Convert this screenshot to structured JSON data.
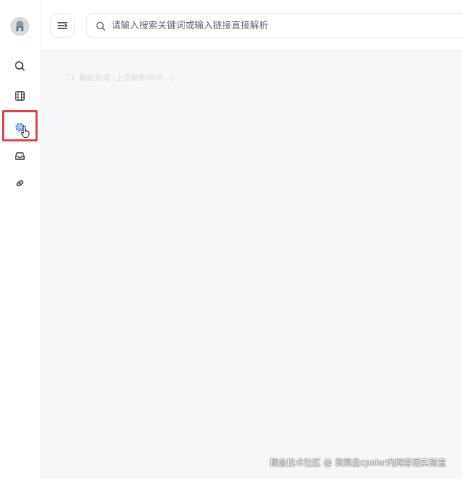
{
  "sidebar": {
    "items": [
      {
        "icon": "search-icon"
      },
      {
        "icon": "film-icon"
      },
      {
        "icon": "gear-icon",
        "active": true
      },
      {
        "icon": "inbox-icon"
      },
      {
        "icon": "link-icon"
      }
    ]
  },
  "header": {
    "menu_icon": "menu-icon",
    "search": {
      "placeholder": "请输入搜索关键词或输入链接直接解析",
      "value": ""
    }
  },
  "main": {
    "status_text": "最新资源 (上次刷新时间...)"
  },
  "watermark": "掘金技术社区 @ 袁熙丞cpolar内网穿透实验室",
  "colors": {
    "accent": "#3b82f6",
    "highlight_border": "#e04343",
    "background": "#f6f7f9"
  }
}
